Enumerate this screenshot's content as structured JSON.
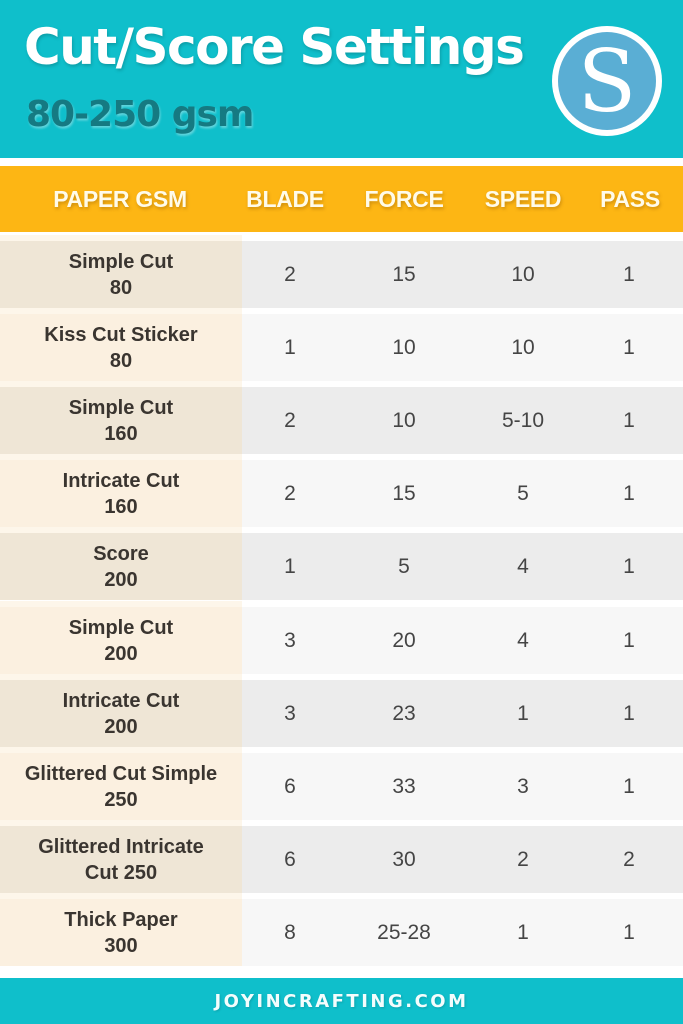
{
  "header": {
    "title": "Cut/Score Settings",
    "subtitle": "80-250 gsm",
    "logo_icon": "silhouette-s-logo-icon",
    "logo_letter": "S"
  },
  "colors": {
    "banner_teal": "#0fbfcb",
    "subtitle_teal_dark": "#157a82",
    "header_orange": "#fdb614",
    "logo_blue": "#5aaed4"
  },
  "table": {
    "columns": [
      "PAPER GSM",
      "BLADE",
      "FORCE",
      "SPEED",
      "PASS"
    ],
    "rows": [
      {
        "label_line1": "Simple Cut",
        "label_line2": "80",
        "blade": "2",
        "force": "15",
        "speed": "10",
        "pass": "1"
      },
      {
        "label_line1": "Kiss Cut Sticker",
        "label_line2": "80",
        "blade": "1",
        "force": "10",
        "speed": "10",
        "pass": "1"
      },
      {
        "label_line1": "Simple Cut",
        "label_line2": "160",
        "blade": "2",
        "force": "10",
        "speed": "5-10",
        "pass": "1"
      },
      {
        "label_line1": "Intricate Cut",
        "label_line2": "160",
        "blade": "2",
        "force": "15",
        "speed": "5",
        "pass": "1"
      },
      {
        "label_line1": "Score",
        "label_line2": "200",
        "blade": "1",
        "force": "5",
        "speed": "4",
        "pass": "1"
      },
      {
        "label_line1": "Simple Cut",
        "label_line2": "200",
        "blade": "3",
        "force": "20",
        "speed": "4",
        "pass": "1"
      },
      {
        "label_line1": "Intricate Cut",
        "label_line2": "200",
        "blade": "3",
        "force": "23",
        "speed": "1",
        "pass": "1"
      },
      {
        "label_line1": "Glittered Cut Simple",
        "label_line2": "250",
        "blade": "6",
        "force": "33",
        "speed": "3",
        "pass": "1"
      },
      {
        "label_line1": "Glittered Intricate",
        "label_line2": "Cut 250",
        "blade": "6",
        "force": "30",
        "speed": "2",
        "pass": "2"
      },
      {
        "label_line1": "Thick Paper",
        "label_line2": "300",
        "blade": "8",
        "force": "25-28",
        "speed": "1",
        "pass": "1"
      }
    ]
  },
  "footer": {
    "site": "JOYINCRAFTING.COM"
  }
}
